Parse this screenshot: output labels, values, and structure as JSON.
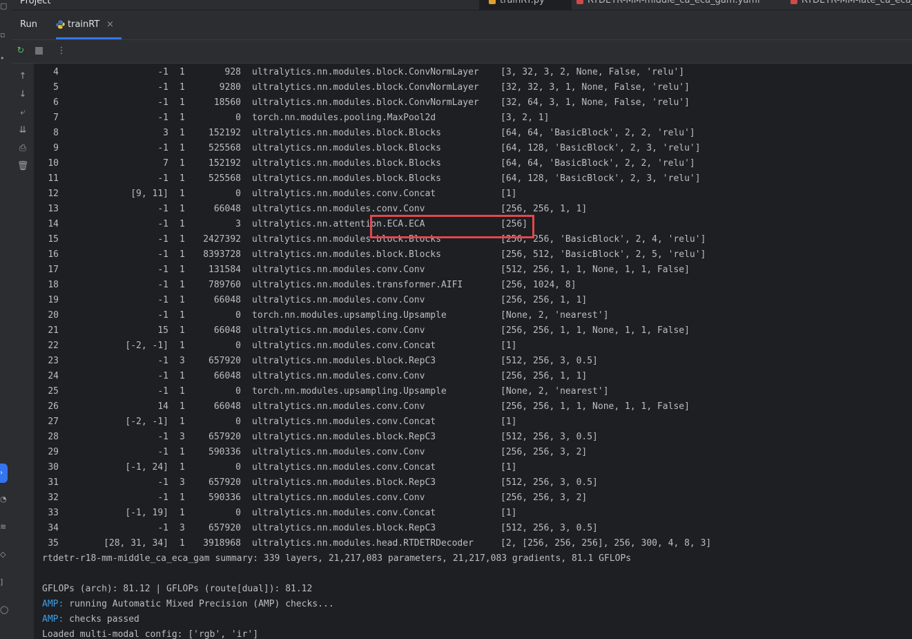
{
  "window": {
    "project_label": "Project",
    "editor_tabs": [
      {
        "label": "trainRT.py",
        "color": "#e0a030"
      },
      {
        "label": "RTDETR-MM-middle_ca_eca_gam.yaml",
        "color": "#d04a4a"
      },
      {
        "label": "RTDETR-MM-late_ca_eca_gam.yaml",
        "color": "#d04a4a"
      }
    ]
  },
  "run_panel": {
    "title": "Run",
    "tab_label": "trainRT",
    "tab_close": "×"
  },
  "toolbar": {
    "rerun_icon": "rerun-icon",
    "stop_icon": "stop-icon",
    "more_icon": "more-vertical-icon"
  },
  "side_tools": [
    "arrow-up-icon",
    "arrow-down-icon",
    "soft-wrap-icon",
    "scroll-to-end-icon",
    "print-icon",
    "trash-icon"
  ],
  "layers": [
    {
      "idx": "4",
      "from": "-1",
      "n": "1",
      "params": "928",
      "module": "ultralytics.nn.modules.block.ConvNormLayer",
      "args": "[3, 32, 3, 2, None, False, 'relu']"
    },
    {
      "idx": "5",
      "from": "-1",
      "n": "1",
      "params": "9280",
      "module": "ultralytics.nn.modules.block.ConvNormLayer",
      "args": "[32, 32, 3, 1, None, False, 'relu']"
    },
    {
      "idx": "6",
      "from": "-1",
      "n": "1",
      "params": "18560",
      "module": "ultralytics.nn.modules.block.ConvNormLayer",
      "args": "[32, 64, 3, 1, None, False, 'relu']"
    },
    {
      "idx": "7",
      "from": "-1",
      "n": "1",
      "params": "0",
      "module": "torch.nn.modules.pooling.MaxPool2d",
      "args": "[3, 2, 1]"
    },
    {
      "idx": "8",
      "from": "3",
      "n": "1",
      "params": "152192",
      "module": "ultralytics.nn.modules.block.Blocks",
      "args": "[64, 64, 'BasicBlock', 2, 2, 'relu']"
    },
    {
      "idx": "9",
      "from": "-1",
      "n": "1",
      "params": "525568",
      "module": "ultralytics.nn.modules.block.Blocks",
      "args": "[64, 128, 'BasicBlock', 2, 3, 'relu']"
    },
    {
      "idx": "10",
      "from": "7",
      "n": "1",
      "params": "152192",
      "module": "ultralytics.nn.modules.block.Blocks",
      "args": "[64, 64, 'BasicBlock', 2, 2, 'relu']"
    },
    {
      "idx": "11",
      "from": "-1",
      "n": "1",
      "params": "525568",
      "module": "ultralytics.nn.modules.block.Blocks",
      "args": "[64, 128, 'BasicBlock', 2, 3, 'relu']"
    },
    {
      "idx": "12",
      "from": "[9, 11]",
      "n": "1",
      "params": "0",
      "module": "ultralytics.nn.modules.conv.Concat",
      "args": "[1]"
    },
    {
      "idx": "13",
      "from": "-1",
      "n": "1",
      "params": "66048",
      "module": "ultralytics.nn.modules.conv.Conv",
      "args": "[256, 256, 1, 1]"
    },
    {
      "idx": "14",
      "from": "-1",
      "n": "1",
      "params": "3",
      "module": "ultralytics.nn.attention.ECA.ECA",
      "args": "[256]"
    },
    {
      "idx": "15",
      "from": "-1",
      "n": "1",
      "params": "2427392",
      "module": "ultralytics.nn.modules.block.Blocks",
      "args": "[256, 256, 'BasicBlock', 2, 4, 'relu']"
    },
    {
      "idx": "16",
      "from": "-1",
      "n": "1",
      "params": "8393728",
      "module": "ultralytics.nn.modules.block.Blocks",
      "args": "[256, 512, 'BasicBlock', 2, 5, 'relu']"
    },
    {
      "idx": "17",
      "from": "-1",
      "n": "1",
      "params": "131584",
      "module": "ultralytics.nn.modules.conv.Conv",
      "args": "[512, 256, 1, 1, None, 1, 1, False]"
    },
    {
      "idx": "18",
      "from": "-1",
      "n": "1",
      "params": "789760",
      "module": "ultralytics.nn.modules.transformer.AIFI",
      "args": "[256, 1024, 8]"
    },
    {
      "idx": "19",
      "from": "-1",
      "n": "1",
      "params": "66048",
      "module": "ultralytics.nn.modules.conv.Conv",
      "args": "[256, 256, 1, 1]"
    },
    {
      "idx": "20",
      "from": "-1",
      "n": "1",
      "params": "0",
      "module": "torch.nn.modules.upsampling.Upsample",
      "args": "[None, 2, 'nearest']"
    },
    {
      "idx": "21",
      "from": "15",
      "n": "1",
      "params": "66048",
      "module": "ultralytics.nn.modules.conv.Conv",
      "args": "[256, 256, 1, 1, None, 1, 1, False]"
    },
    {
      "idx": "22",
      "from": "[-2, -1]",
      "n": "1",
      "params": "0",
      "module": "ultralytics.nn.modules.conv.Concat",
      "args": "[1]"
    },
    {
      "idx": "23",
      "from": "-1",
      "n": "3",
      "params": "657920",
      "module": "ultralytics.nn.modules.block.RepC3",
      "args": "[512, 256, 3, 0.5]"
    },
    {
      "idx": "24",
      "from": "-1",
      "n": "1",
      "params": "66048",
      "module": "ultralytics.nn.modules.conv.Conv",
      "args": "[256, 256, 1, 1]"
    },
    {
      "idx": "25",
      "from": "-1",
      "n": "1",
      "params": "0",
      "module": "torch.nn.modules.upsampling.Upsample",
      "args": "[None, 2, 'nearest']"
    },
    {
      "idx": "26",
      "from": "14",
      "n": "1",
      "params": "66048",
      "module": "ultralytics.nn.modules.conv.Conv",
      "args": "[256, 256, 1, 1, None, 1, 1, False]"
    },
    {
      "idx": "27",
      "from": "[-2, -1]",
      "n": "1",
      "params": "0",
      "module": "ultralytics.nn.modules.conv.Concat",
      "args": "[1]"
    },
    {
      "idx": "28",
      "from": "-1",
      "n": "3",
      "params": "657920",
      "module": "ultralytics.nn.modules.block.RepC3",
      "args": "[512, 256, 3, 0.5]"
    },
    {
      "idx": "29",
      "from": "-1",
      "n": "1",
      "params": "590336",
      "module": "ultralytics.nn.modules.conv.Conv",
      "args": "[256, 256, 3, 2]"
    },
    {
      "idx": "30",
      "from": "[-1, 24]",
      "n": "1",
      "params": "0",
      "module": "ultralytics.nn.modules.conv.Concat",
      "args": "[1]"
    },
    {
      "idx": "31",
      "from": "-1",
      "n": "3",
      "params": "657920",
      "module": "ultralytics.nn.modules.block.RepC3",
      "args": "[512, 256, 3, 0.5]"
    },
    {
      "idx": "32",
      "from": "-1",
      "n": "1",
      "params": "590336",
      "module": "ultralytics.nn.modules.conv.Conv",
      "args": "[256, 256, 3, 2]"
    },
    {
      "idx": "33",
      "from": "[-1, 19]",
      "n": "1",
      "params": "0",
      "module": "ultralytics.nn.modules.conv.Concat",
      "args": "[1]"
    },
    {
      "idx": "34",
      "from": "-1",
      "n": "3",
      "params": "657920",
      "module": "ultralytics.nn.modules.block.RepC3",
      "args": "[512, 256, 3, 0.5]"
    },
    {
      "idx": "35",
      "from": "[28, 31, 34]",
      "n": "1",
      "params": "3918968",
      "module": "ultralytics.nn.modules.head.RTDETRDecoder",
      "args": "[2, [256, 256, 256], 256, 300, 4, 8, 3]"
    }
  ],
  "summary": "rtdetr-r18-mm-middle_ca_eca_gam summary: 339 layers, 21,217,083 parameters, 21,217,083 gradients, 81.1 GFLOPs",
  "gflops_line": "GFLOPs (arch): 81.12 | GFLOPs (route[dual]): 81.12",
  "amp_lines": [
    {
      "prefix": "AMP:",
      "text": " running Automatic Mixed Precision (AMP) checks..."
    },
    {
      "prefix": "AMP:",
      "text": " checks passed"
    }
  ],
  "last_line": "Loaded multi-modal config: ['rgb', 'ir']",
  "highlight_color": "#e2474f",
  "accent_color": "#3574f0"
}
